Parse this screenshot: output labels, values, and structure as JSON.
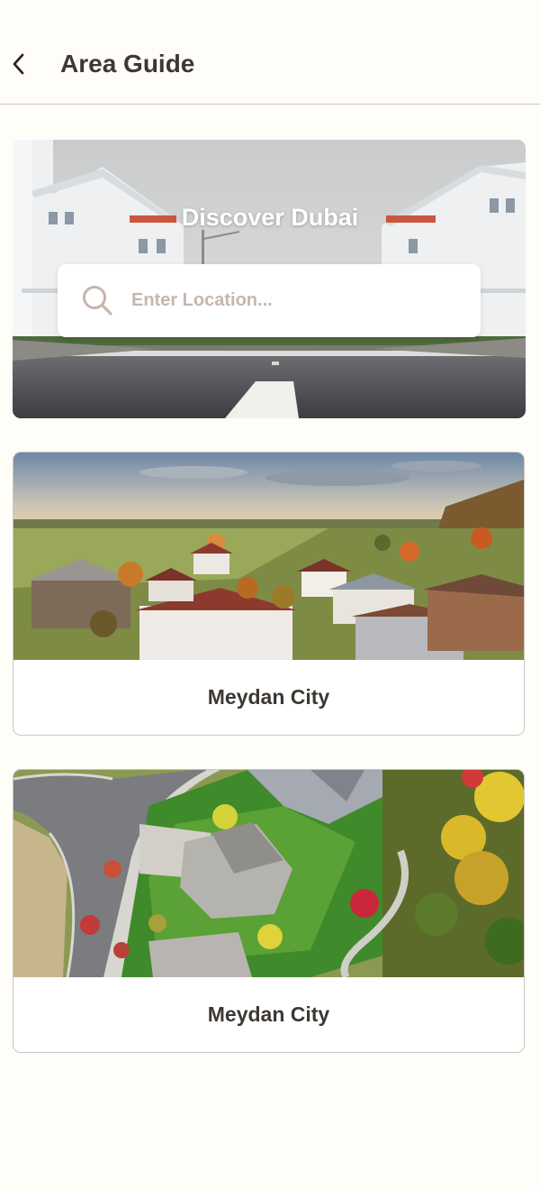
{
  "header": {
    "title": "Area Guide"
  },
  "hero": {
    "title": "Discover Dubai",
    "search": {
      "placeholder": "Enter Location...",
      "value": ""
    }
  },
  "areas": [
    {
      "name": "Meydan City",
      "image": "village-aerial-photo"
    },
    {
      "name": "Meydan City",
      "image": "suburban-houses-aerial-photo"
    }
  ],
  "colors": {
    "background": "#fffdf8",
    "text": "#3d3833",
    "placeholder": "#c7b6ad",
    "divider": "#cfcac3"
  },
  "icons": [
    "back-arrow-icon",
    "search-icon"
  ]
}
